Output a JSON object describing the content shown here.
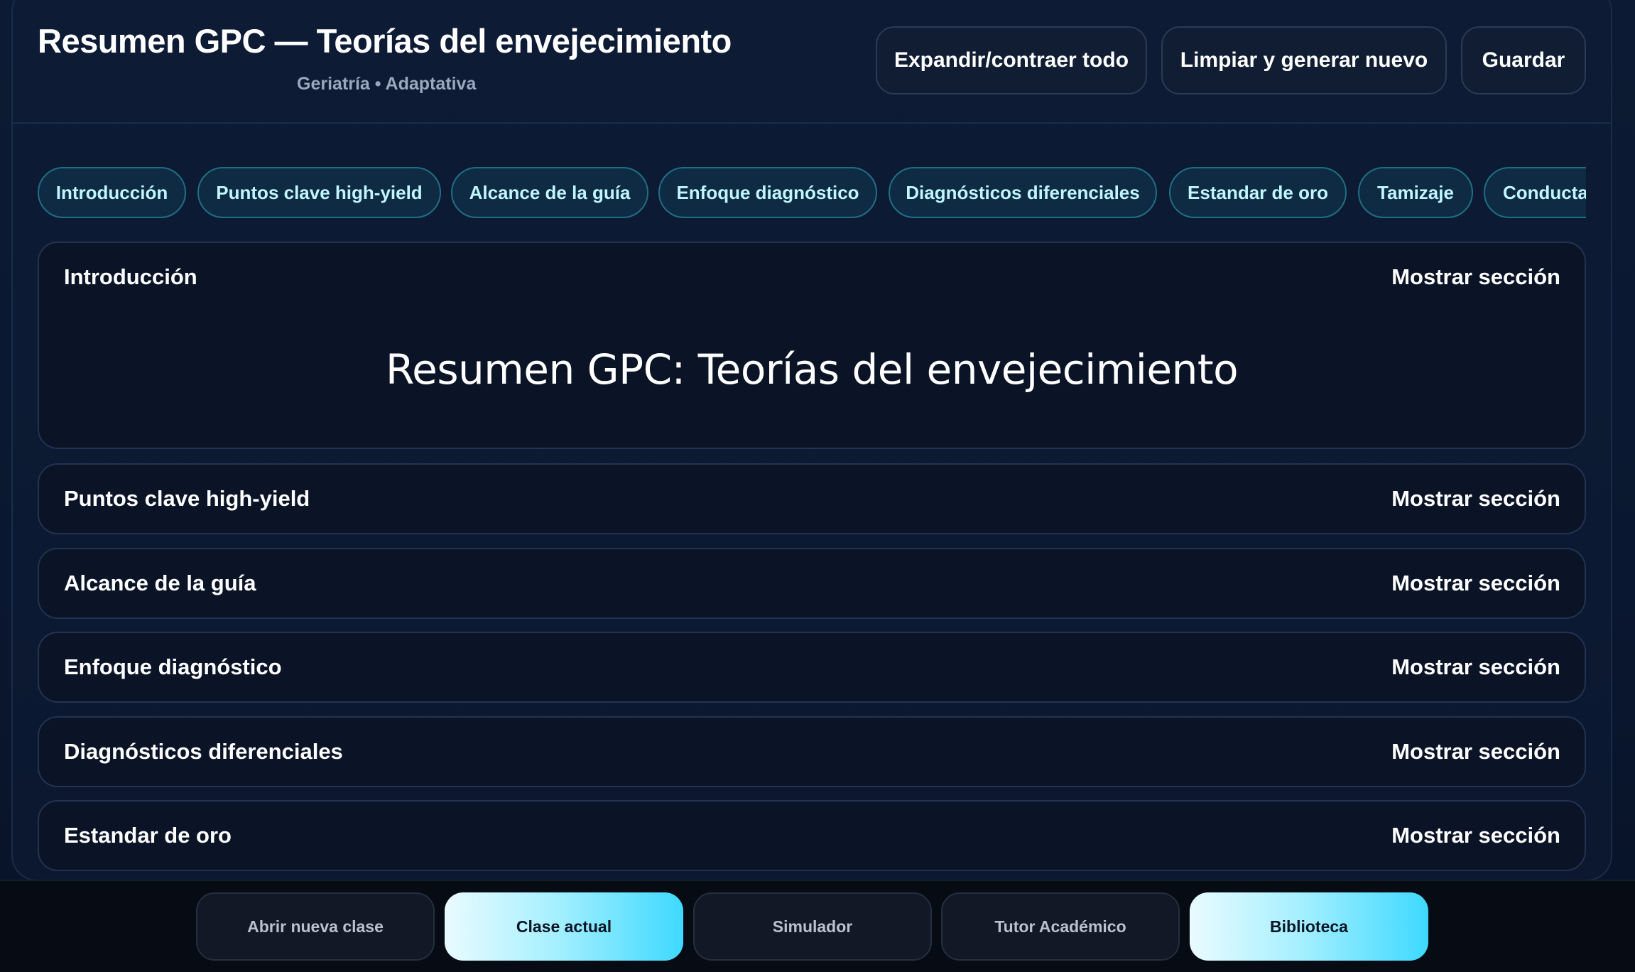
{
  "header": {
    "title": "Resumen GPC — Teorías del envejecimiento",
    "subtitle": "Geriatría • Adaptativa",
    "buttons": {
      "expand": "Expandir/contraer todo",
      "clear": "Limpiar y generar nuevo",
      "save": "Guardar"
    }
  },
  "tabs": [
    "Introducción",
    "Puntos clave high-yield",
    "Alcance de la guía",
    "Enfoque diagnóstico",
    "Diagnósticos diferenciales",
    "Estandar de oro",
    "Tamizaje",
    "Conducta"
  ],
  "sections": [
    {
      "title": "Introducción",
      "toggle": "Mostrar sección",
      "heading": "Resumen GPC: Teorías del envejecimiento"
    },
    {
      "title": "Puntos clave high-yield",
      "toggle": "Mostrar sección"
    },
    {
      "title": "Alcance de la guía",
      "toggle": "Mostrar sección"
    },
    {
      "title": "Enfoque diagnóstico",
      "toggle": "Mostrar sección"
    },
    {
      "title": "Diagnósticos diferenciales",
      "toggle": "Mostrar sección"
    },
    {
      "title": "Estandar de oro",
      "toggle": "Mostrar sección"
    }
  ],
  "bottom_nav": [
    {
      "label": "Abrir nueva clase",
      "active": false
    },
    {
      "label": "Clase actual",
      "active": true
    },
    {
      "label": "Simulador",
      "active": false
    },
    {
      "label": "Tutor Académico",
      "active": false
    },
    {
      "label": "Biblioteca",
      "active": true
    }
  ],
  "colors": {
    "background": "#0b1830",
    "chip_border": "#1f6f84",
    "chip_text": "#bff6ff",
    "accent_start": "#e9fbff",
    "accent_end": "#3ed9ff"
  }
}
